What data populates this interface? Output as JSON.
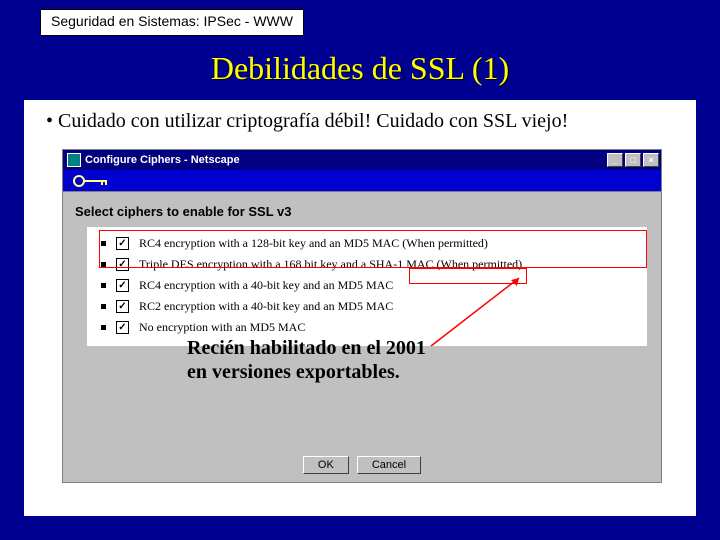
{
  "header": {
    "label": "Seguridad en Sistemas: IPSec - WWW"
  },
  "title": "Debilidades de SSL (1)",
  "bullet": "• Cuidado con utilizar criptografía débil! Cuidado con SSL viejo!",
  "window": {
    "title": "Configure Ciphers - Netscape",
    "minimize": "_",
    "maximize": "□",
    "close": "×",
    "heading": "Select ciphers to enable for SSL v3",
    "ciphers": [
      {
        "checked": true,
        "label": "RC4 encryption with a 128-bit key and an MD5 MAC (When permitted)"
      },
      {
        "checked": true,
        "label": "Triple DES encryption with a 168 bit key and a SHA-1 MAC (When permitted)"
      },
      {
        "checked": true,
        "label": "RC4 encryption with a 40-bit key and an MD5 MAC"
      },
      {
        "checked": true,
        "label": "RC2 encryption with a 40-bit key and an MD5 MAC"
      },
      {
        "checked": true,
        "label": "No encryption with an MD5 MAC"
      }
    ],
    "buttons": {
      "ok": "OK",
      "cancel": "Cancel"
    }
  },
  "annotation": {
    "line1": "Recién habilitado en el 2001",
    "line2": "en versiones exportables."
  }
}
